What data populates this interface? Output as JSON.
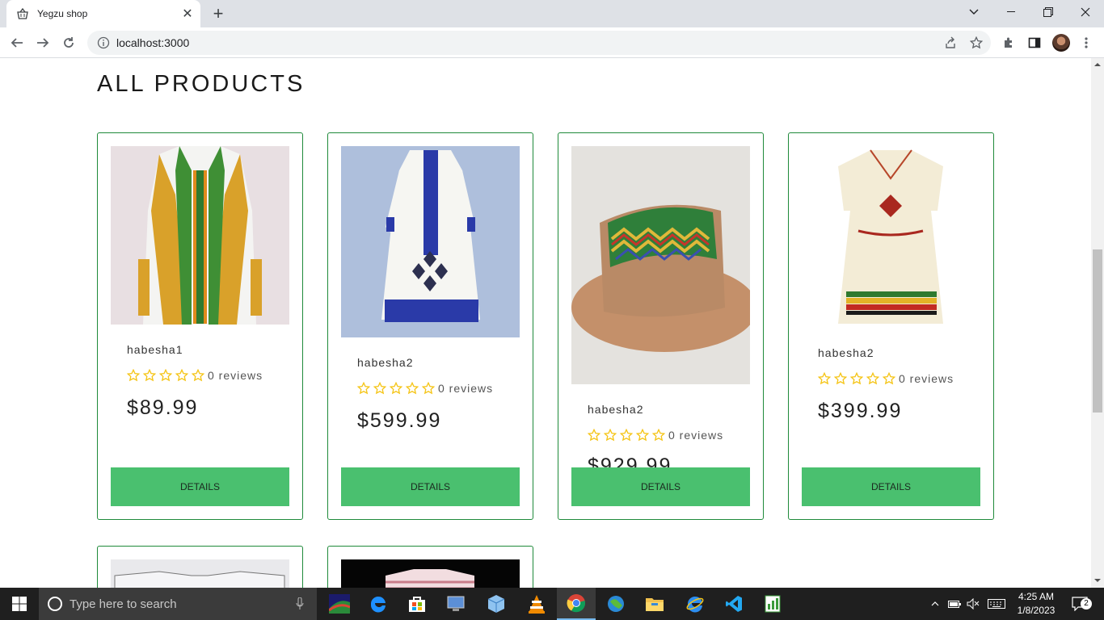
{
  "browser": {
    "tab_title": "Yegzu shop",
    "url": "localhost:3000"
  },
  "page": {
    "heading": "ALL PRODUCTS",
    "products": [
      {
        "name": "habesha1",
        "reviews": "0 reviews",
        "price": "$89.99",
        "button": "DETAILS",
        "stars": 0
      },
      {
        "name": "habesha2",
        "reviews": "0 reviews",
        "price": "$599.99",
        "button": "DETAILS",
        "stars": 0
      },
      {
        "name": "habesha2",
        "reviews": "0 reviews",
        "price": "$929.99",
        "button": "DETAILS",
        "stars": 0
      },
      {
        "name": "habesha2",
        "reviews": "0 reviews",
        "price": "$399.99",
        "button": "DETAILS",
        "stars": 0
      }
    ]
  },
  "taskbar": {
    "search_placeholder": "Type here to search",
    "time": "4:25 AM",
    "date": "1/8/2023",
    "notification_count": "2"
  },
  "colors": {
    "accent_green": "#4ac06f",
    "card_border": "#1f8a3a",
    "star": "#f5c518"
  }
}
